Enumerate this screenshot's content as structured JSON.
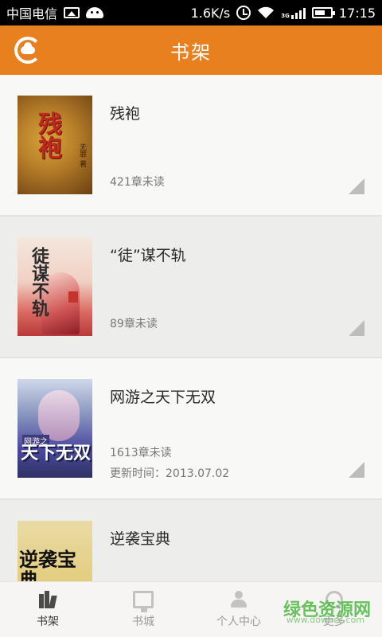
{
  "status_bar": {
    "carrier": "中国电信",
    "speed": "1.6K/s",
    "network": "3G",
    "time": "17:15"
  },
  "header": {
    "title": "书架"
  },
  "books": [
    {
      "title": "残袍",
      "cover_text": "残袍",
      "cover_author": "无罪 著",
      "unread": "421章未读",
      "updated": ""
    },
    {
      "title": "“徒”谋不轨",
      "cover_text": "徒谋不轨",
      "unread": "89章未读",
      "updated": ""
    },
    {
      "title": "网游之天下无双",
      "cover_text": "天下无双",
      "cover_sub": "网游之",
      "unread": "1613章未读",
      "updated": "更新时间：2013.07.02"
    },
    {
      "title": "逆袭宝典",
      "cover_text": "逆袭宝典",
      "unread": "",
      "updated": ""
    }
  ],
  "bottom_nav": {
    "items": [
      {
        "label": "书架",
        "icon": "bookshelf-icon",
        "active": true
      },
      {
        "label": "书城",
        "icon": "bookstore-icon",
        "active": false
      },
      {
        "label": "个人中心",
        "icon": "user-icon",
        "active": false
      },
      {
        "label": "更多",
        "icon": "more-icon",
        "active": false
      }
    ]
  },
  "watermark": {
    "text": "绿色资源网",
    "url": "www.downcc.com"
  },
  "colors": {
    "accent": "#e9801f",
    "watermark": "#4fb944"
  }
}
